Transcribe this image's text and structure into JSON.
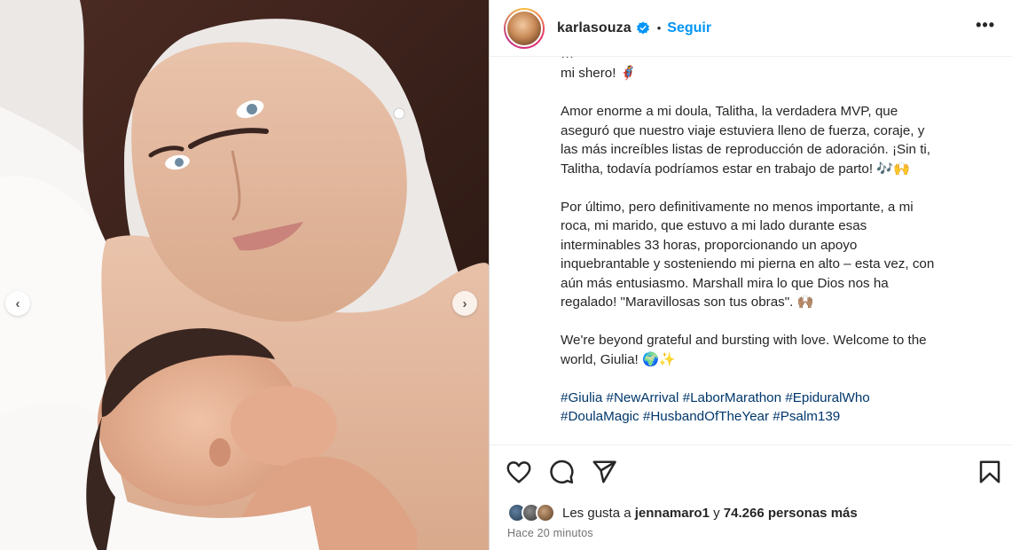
{
  "photo": {
    "alt": "Selfie of a woman lying in bed with a newborn baby on her chest",
    "prev_label": "‹",
    "next_label": "›"
  },
  "header": {
    "username": "karlasouza",
    "separator": "•",
    "follow_label": "Seguir",
    "more_label": "•••"
  },
  "caption": {
    "cut_line": "…",
    "lines": [
      "mi shero! 🦸‍♀️",
      "",
      "Amor enorme a mi doula, Talitha, la verdadera MVP, que",
      "aseguró que nuestro viaje estuviera lleno de fuerza, coraje, y",
      "las más increíbles listas de reproducción de adoración. ¡Sin ti,",
      "Talitha, todavía podríamos estar en trabajo de parto! 🎶🙌",
      "",
      "Por último, pero definitivamente no menos importante, a mi",
      "roca, mi marido, que estuvo a mi lado durante esas",
      "interminables 33 horas, proporcionando un apoyo",
      "inquebrantable y sosteniendo mi pierna en alto – esta vez, con",
      "aún más entusiasmo. Marshall mira lo que Dios nos ha",
      "regalado! \"Maravillosas son tus obras\". 🙌🏽",
      "",
      "We're beyond grateful and bursting with love. Welcome to the",
      "world, Giulia! 🌍✨"
    ],
    "hashtags_line1": [
      "#Giulia",
      "#NewArrival",
      "#LaborMarathon",
      "#EpiduralWho"
    ],
    "hashtags_line2": [
      "#DoulaMagic",
      "#HusbandOfTheYear",
      "#Psalm139"
    ]
  },
  "actions": {
    "like_icon": "heart-icon",
    "comment_icon": "comment-icon",
    "share_icon": "paper-plane-icon",
    "save_icon": "bookmark-icon"
  },
  "likes": {
    "prefix": "Les gusta a",
    "user": "jennamaro1",
    "middle": "y",
    "count": "74.266 personas más"
  },
  "time": "Hace 20 minutos",
  "colors": {
    "follow": "#0095f6",
    "hashtag": "#00376b",
    "text": "#262626",
    "muted": "#737373",
    "verified": "#0095f6"
  }
}
